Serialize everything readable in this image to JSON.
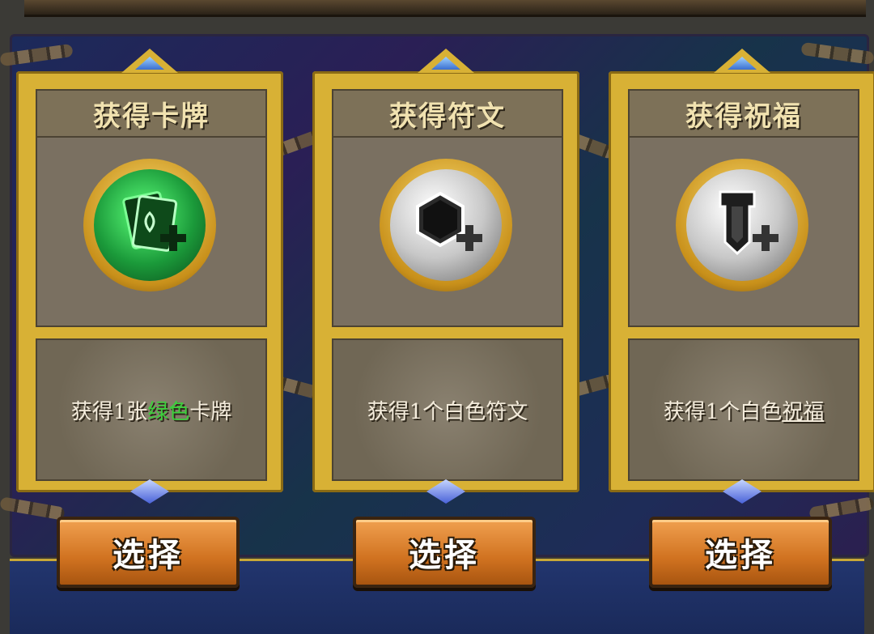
{
  "cards": [
    {
      "title": "获得卡牌",
      "icon": "green-card-plus-icon",
      "desc_prefix": "获得1张",
      "desc_highlight": "绿色",
      "desc_suffix": "卡牌",
      "highlight_color": "#3ccf3c",
      "button_label": "选择"
    },
    {
      "title": "获得符文",
      "icon": "white-hexagon-rune-plus-icon",
      "desc_prefix": "获得1个白色符文",
      "desc_highlight": "",
      "desc_suffix": "",
      "button_label": "选择"
    },
    {
      "title": "获得祝福",
      "icon": "white-banner-blessing-plus-icon",
      "desc_prefix": "获得1个白色",
      "desc_highlight": "祝福",
      "desc_suffix": "",
      "button_label": "选择"
    }
  ],
  "colors": {
    "frame_gold": "#d8b135",
    "button_orange": "#d07220",
    "title_text": "#f1e2b0"
  }
}
